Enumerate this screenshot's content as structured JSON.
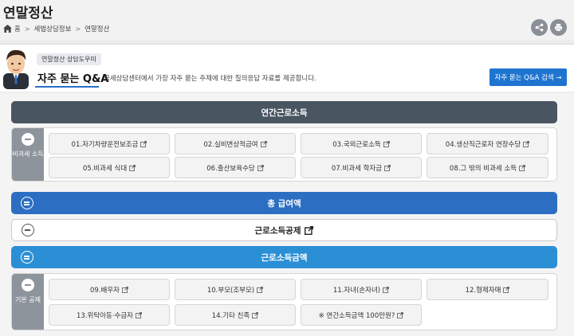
{
  "page": {
    "title": "연말정산"
  },
  "breadcrumb": [
    "홈",
    "세법상담정보",
    "연말정산"
  ],
  "helper": {
    "badge": "연말정산 상담도우미",
    "title": "자주 묻는 Q&A",
    "description": "국세상담센터에서 가장 자주 묻는 주제에 대한 질의응답 자료를 제공합니다.",
    "search_button": "자주 묻는 Q&A 검색 →"
  },
  "sections": {
    "annual_income": "연간근로소득",
    "nontax_label": "비과세 소득",
    "nontax_items": [
      "01.자기차량운전보조금",
      "02.실비변상적급여",
      "03.국외근로소득",
      "04.생산직근로자 연장수당",
      "05.비과세 식대",
      "06.출산보육수당",
      "07.비과세 학자금",
      "08.그 밖의 비과세 소득"
    ],
    "total_pay": "총 급여액",
    "income_deduction": "근로소득공제",
    "income_amount": "근로소득금액",
    "basic_label": "기본 공제",
    "basic_items": [
      "09.배우자",
      "10.부모(조부모)",
      "11.자녀(손자녀)",
      "12.형제자매",
      "13.위탁아동·수급자",
      "14.기타 친족",
      "※ 연간소득금액 100만원?"
    ]
  },
  "colors": {
    "dark": "#4a5562",
    "blue": "#2c6fc2",
    "sky": "#2b8fd6",
    "button": "#1f74d0"
  }
}
